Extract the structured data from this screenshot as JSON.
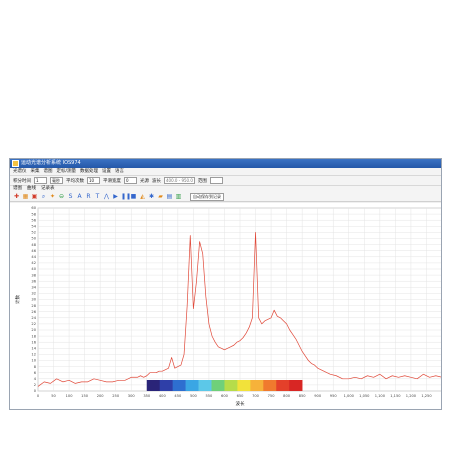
{
  "window": {
    "title": "运动光谱分析系统 IOS974"
  },
  "menu": [
    "光谱仪",
    "采集",
    "谱图",
    "定标/测量",
    "数据处理",
    "设置",
    "语言"
  ],
  "params": {
    "integration_label": "积分时间",
    "integration_value": "1",
    "unit_value": "毫秒",
    "average_label": "平均次数",
    "average_value": "10",
    "smooth_label": "平滑宽度",
    "smooth_value": "0",
    "lightsource_label": "光源",
    "wavelength_label": "波长",
    "wavelength_value": "400.0 - 950.0",
    "range_label": "范围",
    "range_value": ""
  },
  "tabs": [
    "谱图",
    "曲线",
    "记录表"
  ],
  "toolbar": {
    "icons": [
      "add-icon",
      "grid-icon",
      "save-icon",
      "zoom-icon",
      "star-icon",
      "zoom-out-icon",
      "s-icon",
      "a-icon",
      "r-icon",
      "t-icon",
      "peak-icon",
      "play-icon",
      "pause-icon",
      "stop-icon",
      "chart-icon",
      "settings-icon",
      "folder-icon",
      "disk-icon",
      "print-icon"
    ],
    "dropdown_value": "自动保存到记录"
  },
  "chart_data": {
    "type": "line",
    "xlabel": "波长",
    "ylabel": "计数",
    "xlim": [
      0,
      1300
    ],
    "ylim": [
      0,
      60
    ],
    "xticks": [
      "0",
      "50",
      "100",
      "150",
      "200",
      "250",
      "300",
      "350",
      "400",
      "450",
      "500",
      "550",
      "600",
      "650",
      "700",
      "750",
      "800",
      "850",
      "900",
      "950",
      "1,000",
      "1,050",
      "1,100",
      "1,150",
      "1,200",
      "1,250"
    ],
    "yticks": [
      "0",
      "2",
      "4",
      "6",
      "8",
      "10",
      "12",
      "14",
      "16",
      "18",
      "20",
      "22",
      "24",
      "26",
      "28",
      "30",
      "32",
      "34",
      "36",
      "38",
      "40",
      "42",
      "44",
      "46",
      "48",
      "50",
      "52",
      "54",
      "56",
      "58",
      "60"
    ],
    "grid": true,
    "line_color": "#e04838",
    "x": [
      0,
      20,
      40,
      60,
      80,
      100,
      120,
      140,
      160,
      180,
      200,
      220,
      240,
      260,
      280,
      300,
      320,
      330,
      340,
      350,
      360,
      370,
      380,
      390,
      400,
      410,
      420,
      430,
      440,
      450,
      460,
      470,
      480,
      490,
      500,
      510,
      520,
      530,
      540,
      550,
      560,
      570,
      580,
      590,
      600,
      610,
      620,
      630,
      640,
      650,
      660,
      670,
      680,
      690,
      700,
      710,
      720,
      730,
      740,
      750,
      760,
      770,
      780,
      790,
      800,
      810,
      820,
      830,
      840,
      850,
      860,
      870,
      880,
      890,
      900,
      920,
      940,
      960,
      980,
      1000,
      1020,
      1040,
      1060,
      1080,
      1100,
      1120,
      1140,
      1160,
      1180,
      1200,
      1220,
      1240,
      1260,
      1280,
      1300
    ],
    "y": [
      1.5,
      3.0,
      2.5,
      4.0,
      3.0,
      3.5,
      2.5,
      3.0,
      3.0,
      4.0,
      3.5,
      3.0,
      3.0,
      3.5,
      3.5,
      4.5,
      4.5,
      5.0,
      4.5,
      5.0,
      6.0,
      6.0,
      6.0,
      6.5,
      6.5,
      7.0,
      7.5,
      11.0,
      7.5,
      8.0,
      8.5,
      12.0,
      28.0,
      51.0,
      27.0,
      36.0,
      49.0,
      45.0,
      31.0,
      22.0,
      18.0,
      16.0,
      14.5,
      14.0,
      13.5,
      14.0,
      14.5,
      15.0,
      16.0,
      16.5,
      17.5,
      19.0,
      21.0,
      24.0,
      52.0,
      24.0,
      22.0,
      23.0,
      23.5,
      24.0,
      26.5,
      24.5,
      24.0,
      23.0,
      22.0,
      20.0,
      18.5,
      17.0,
      15.0,
      13.0,
      11.5,
      10.0,
      9.0,
      8.5,
      7.5,
      6.5,
      5.5,
      5.0,
      4.0,
      4.0,
      4.5,
      4.0,
      5.0,
      4.5,
      5.5,
      4.0,
      5.0,
      4.5,
      5.0,
      4.5,
      4.0,
      5.5,
      4.5,
      5.0,
      4.5
    ],
    "colorbar": {
      "x_from": 350,
      "x_to": 850,
      "colors": [
        "#2a2478",
        "#2f3fa8",
        "#2e6fd0",
        "#3aa6e4",
        "#5cc8e8",
        "#6fd07a",
        "#b6dc4a",
        "#f2e23a",
        "#f6b23a",
        "#f07a2e",
        "#e4402a",
        "#d82624"
      ]
    }
  }
}
